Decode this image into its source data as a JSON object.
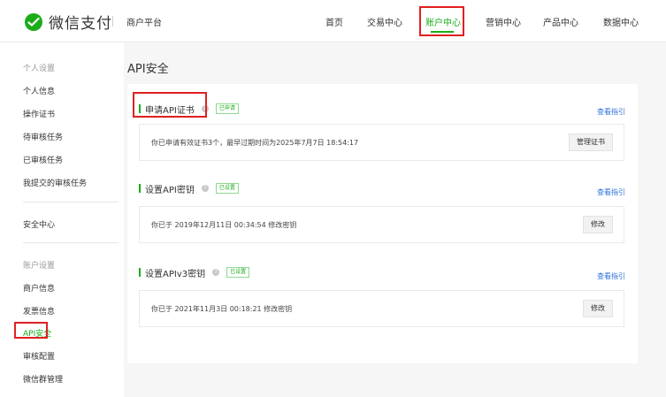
{
  "header": {
    "brand": "微信支付",
    "platform": "商户平台",
    "nav": [
      {
        "label": "首页"
      },
      {
        "label": "交易中心"
      },
      {
        "label": "账户中心"
      },
      {
        "label": "营销中心"
      },
      {
        "label": "产品中心"
      },
      {
        "label": "数据中心"
      }
    ],
    "active_nav": "账户中心"
  },
  "sidebar": {
    "group_personal": "个人设置",
    "personal_items": [
      {
        "label": "个人信息"
      },
      {
        "label": "操作证书"
      },
      {
        "label": "待审核任务"
      },
      {
        "label": "已审核任务"
      },
      {
        "label": "我提交的审核任务"
      }
    ],
    "security_center": "安全中心",
    "group_account": "账户设置",
    "account_items": [
      {
        "label": "商户信息"
      },
      {
        "label": "发票信息"
      },
      {
        "label": "API安全"
      },
      {
        "label": "审核配置"
      },
      {
        "label": "微信群管理"
      }
    ],
    "active_item": "API安全"
  },
  "main": {
    "title": "API安全",
    "sections": [
      {
        "title": "申请API证书",
        "badge": "已申请",
        "guide": "查看指引",
        "info": "你已申请有效证书3个，最早过期时间为2025年7月7日 18:54:17",
        "button": "管理证书"
      },
      {
        "title": "设置API密钥",
        "badge": "已设置",
        "guide": "查看指引",
        "info": "你已于 2019年12月11日 00:34:54 修改密钥",
        "button": "修改"
      },
      {
        "title": "设置APIv3密钥",
        "badge": "已设置",
        "guide": "查看指引",
        "info": "你已于 2021年11月3日 00:18:21 修改密钥",
        "button": "修改"
      }
    ]
  },
  "icons": {
    "logo": "wechat-pay-logo-icon",
    "help": "question-circle-icon"
  },
  "colors": {
    "brand_green": "#1aad19",
    "link_blue": "#2b6fdb",
    "highlight_red": "#e02020"
  }
}
